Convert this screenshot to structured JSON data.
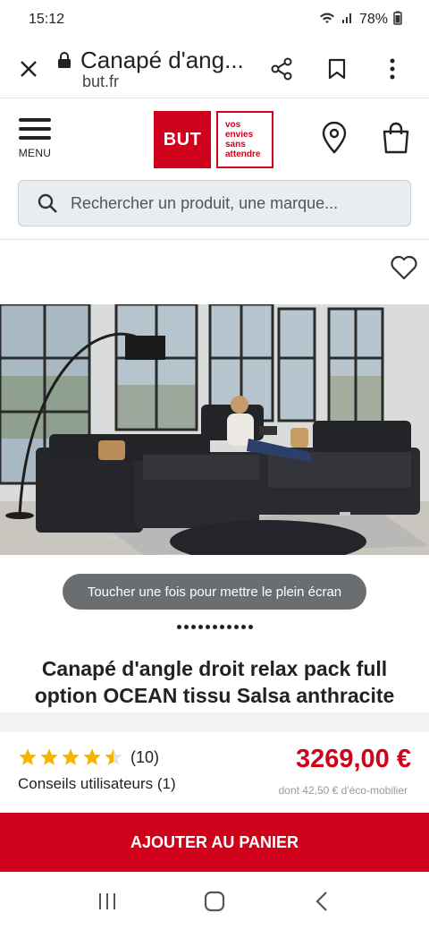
{
  "status_bar": {
    "time": "15:12",
    "battery": "78%"
  },
  "browser": {
    "title": "Canapé d'ang...",
    "domain": "but.fr"
  },
  "header": {
    "menu_label": "MENU",
    "logo_text": "BUT",
    "logo_tagline": [
      "vos",
      "envies",
      "sans",
      "attendre"
    ]
  },
  "search": {
    "placeholder": "Rechercher un produit, une marque..."
  },
  "image_tip": "Toucher une fois pour mettre le plein écran",
  "carousel": {
    "dot_count": 11
  },
  "product": {
    "title": "Canapé d'angle droit relax pack full option OCEAN tissu Salsa anthracite",
    "rating": 4.5,
    "review_count": "(10)",
    "reviews_link": "Conseils utilisateurs (1)",
    "price": "3269,00 €",
    "eco_fee": "dont 42,50 € d'éco-mobilier"
  },
  "cta": {
    "add_to_cart": "AJOUTER AU PANIER"
  },
  "colors": {
    "brand_red": "#d0021b",
    "star_yellow": "#f5b400"
  }
}
